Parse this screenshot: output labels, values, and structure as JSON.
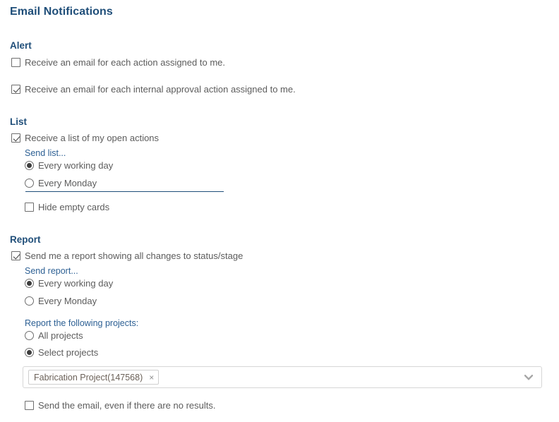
{
  "page": {
    "title": "Email Notifications",
    "accent_heading_color": "#1f4e79",
    "sub_label_color": "#2d6094",
    "body_text_color": "#5c5c5c"
  },
  "sections": {
    "alert": {
      "title": "Alert",
      "options": [
        {
          "label": "Receive an email for each action assigned to me.",
          "checked": false
        },
        {
          "label": "Receive an email for each internal approval action assigned to me.",
          "checked": true
        }
      ]
    },
    "list": {
      "title": "List",
      "enable": {
        "label": "Receive a list of my open actions",
        "checked": true
      },
      "frequency_label": "Send list...",
      "frequency_options": [
        {
          "label": "Every working day",
          "selected": true
        },
        {
          "label": "Every Monday",
          "selected": false
        }
      ],
      "hide_empty": {
        "label": "Hide empty cards",
        "checked": false
      }
    },
    "report": {
      "title": "Report",
      "enable": {
        "label": "Send me a report showing all changes to status/stage",
        "checked": true
      },
      "frequency_label": "Send report...",
      "frequency_options": [
        {
          "label": "Every working day",
          "selected": true
        },
        {
          "label": "Every Monday",
          "selected": false
        }
      ],
      "projects_label": "Report the following projects:",
      "projects_options": [
        {
          "label": "All projects",
          "selected": false
        },
        {
          "label": "Select projects",
          "selected": true
        }
      ],
      "project_select": {
        "chips": [
          {
            "label": "Fabrication Project(147568)",
            "remove_glyph": "×"
          }
        ],
        "dropdown_icon": "chevron-down-icon"
      },
      "send_empty": {
        "label": "Send the email, even if there are no results.",
        "checked": false
      }
    }
  }
}
